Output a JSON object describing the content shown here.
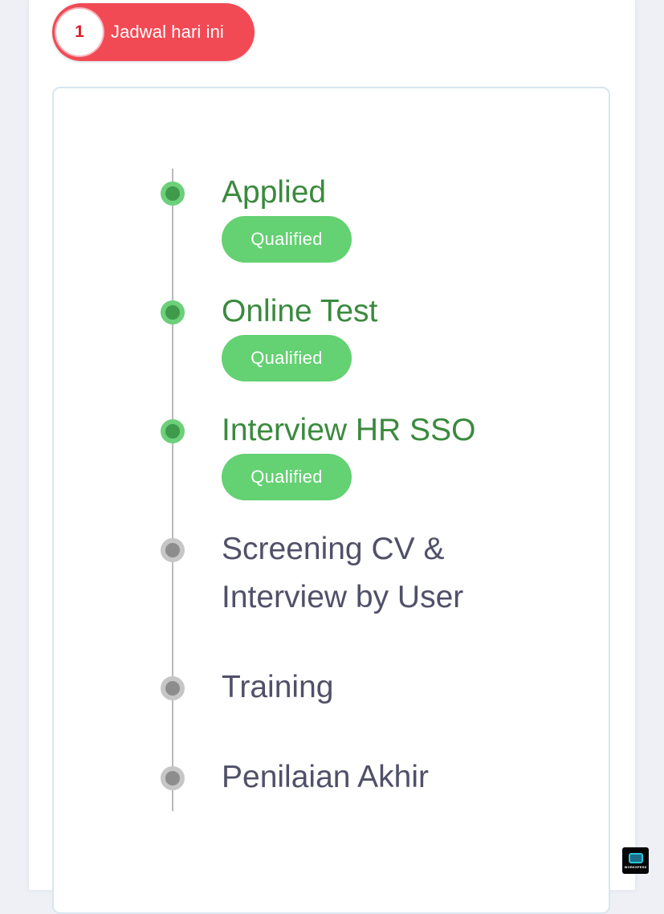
{
  "schedule": {
    "count": "1",
    "label": "Jadwal hari ini"
  },
  "timeline": {
    "steps": [
      {
        "title": "Applied",
        "status": "done",
        "badge": "Qualified"
      },
      {
        "title": "Online Test",
        "status": "done",
        "badge": "Qualified"
      },
      {
        "title": "Interview HR SSO",
        "status": "done",
        "badge": "Qualified"
      },
      {
        "title_line1": "Screening CV &",
        "title_line2": "Interview by User",
        "status": "pending"
      },
      {
        "title": "Training",
        "status": "pending"
      },
      {
        "title": "Penilaian Akhir",
        "status": "pending"
      }
    ]
  },
  "watermark": {
    "text": "WORKSPESS"
  },
  "colors": {
    "accent_red": "#f24a55",
    "done_green": "#3a8a3e",
    "badge_green": "#64d172",
    "pending_text": "#50506a",
    "pending_dot": "#8d8d8d"
  }
}
